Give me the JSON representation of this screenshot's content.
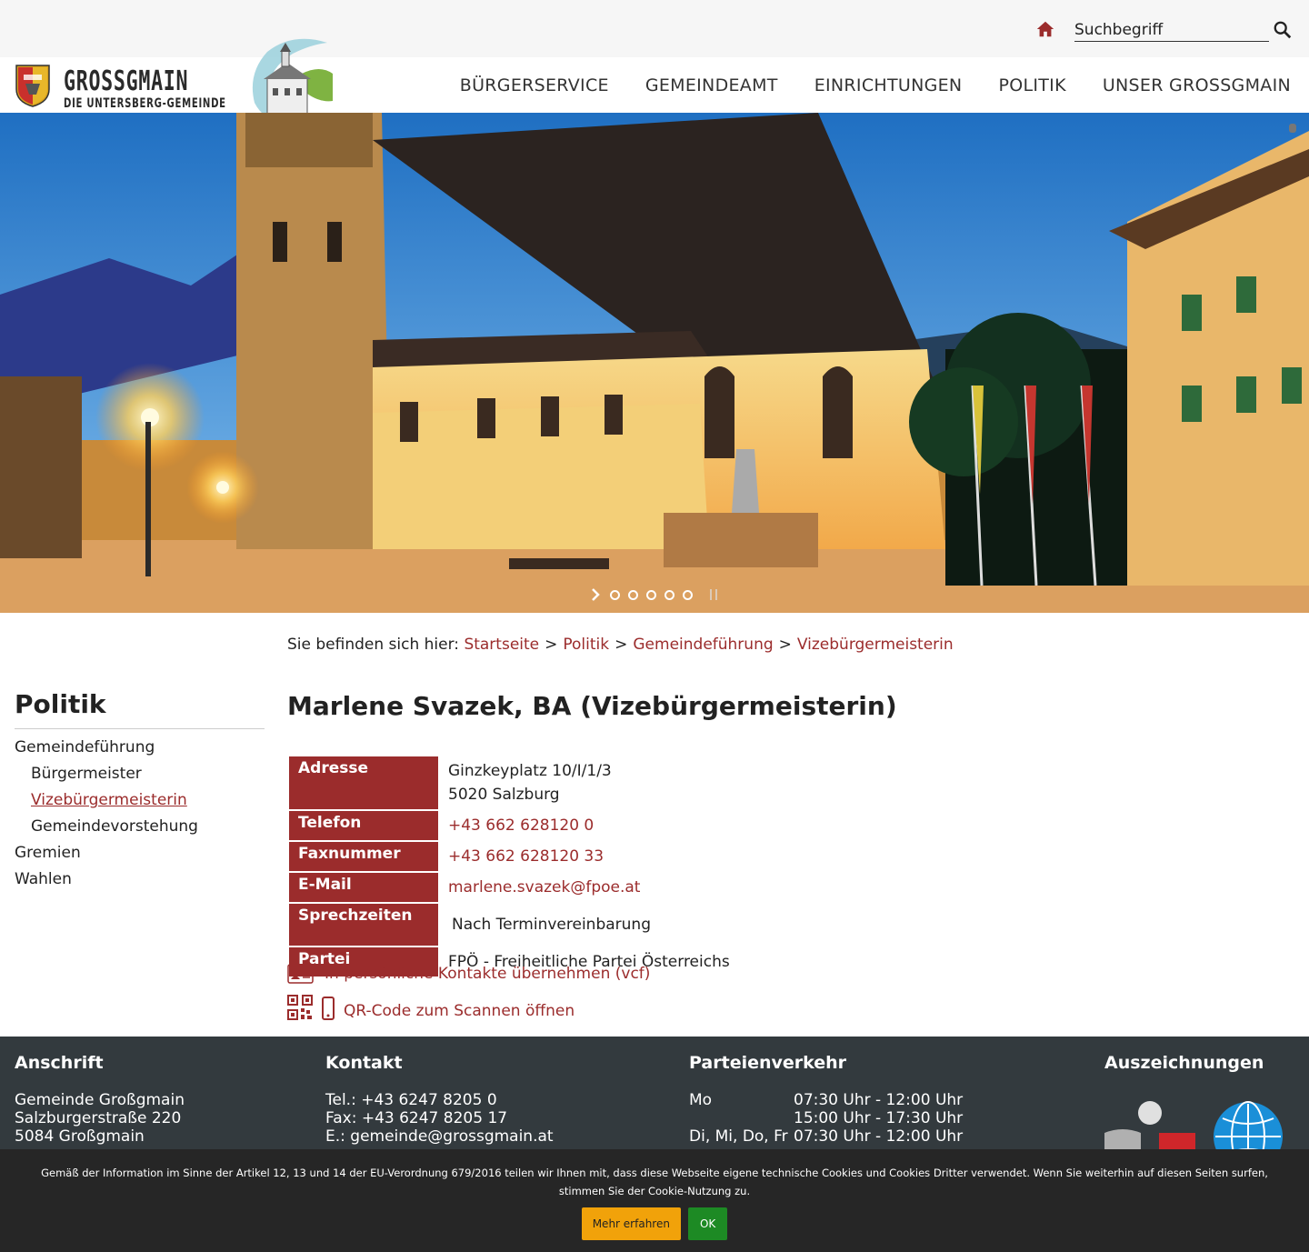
{
  "search": {
    "placeholder": "Suchbegriff"
  },
  "logo": {
    "title": "GROSSGMAIN",
    "subtitle": "DIE UNTERSBERG-GEMEINDE"
  },
  "nav": {
    "items": [
      {
        "label": "BÜRGERSERVICE"
      },
      {
        "label": "GEMEINDEAMT"
      },
      {
        "label": "EINRICHTUNGEN"
      },
      {
        "label": "POLITIK"
      },
      {
        "label": "UNSER GROSSGMAIN"
      }
    ]
  },
  "breadcrumb": {
    "prefix": "Sie befinden sich hier:",
    "items": [
      "Startseite",
      "Politik",
      "Gemeindeführung",
      "Vizebürgermeisterin"
    ],
    "separator": ">"
  },
  "sidebar": {
    "title": "Politik",
    "items": [
      {
        "label": "Gemeindeführung"
      },
      {
        "label": "Bürgermeister"
      },
      {
        "label": "Vizebürgermeisterin"
      },
      {
        "label": "Gemeindevorstehung"
      },
      {
        "label": "Gremien"
      },
      {
        "label": "Wahlen"
      }
    ]
  },
  "main": {
    "title": "Marlene Svazek, BA (Vizebürgermeisterin)",
    "table": {
      "address_label": "Adresse",
      "address_line1": "Ginzkeyplatz 10/I/1/3",
      "address_line2": "5020 Salzburg",
      "phone_label": "Telefon",
      "phone": "+43 662 628120 0",
      "fax_label": "Faxnummer",
      "fax": "+43 662 628120 33",
      "email_label": "E-Mail",
      "email": "marlene.svazek@fpoe.at",
      "hours_label": "Sprechzeiten",
      "hours": "Nach Terminvereinbarung",
      "party_label": "Partei",
      "party": "FPÖ - Freiheitliche Partei Österreichs"
    },
    "vcf_link": "In persönliche Kontakte übernehmen (vcf)",
    "qr_link": "QR-Code zum Scannen öffnen"
  },
  "footer": {
    "address": {
      "title": "Anschrift",
      "line1": "Gemeinde Großgmain",
      "line2": "Salzburgerstraße 220",
      "line3": "5084 Großgmain"
    },
    "contact": {
      "title": "Kontakt",
      "tel": "Tel.: +43 6247 8205 0",
      "fax": "Fax: +43 6247 8205 17",
      "email": "E.: gemeinde@grossgmain.at"
    },
    "hours": {
      "title": "Parteienverkehr",
      "rows": [
        {
          "day": "Mo",
          "time": "07:30 Uhr - 12:00 Uhr"
        },
        {
          "day": "",
          "time": "15:00 Uhr - 17:30 Uhr"
        },
        {
          "day": "Di, Mi, Do, Fr",
          "time": "07:30 Uhr - 12:00 Uhr"
        }
      ]
    },
    "awards": {
      "title": "Auszeichnungen"
    }
  },
  "cookie": {
    "text": "Gemäß der Information im Sinne der Artikel 12, 13 und 14 der EU-Verordnung 679/2016 teilen wir Ihnen mit, dass diese Webseite eigene technische Cookies und Cookies Dritter verwendet. Wenn Sie weiterhin auf diesen Seiten surfen, stimmen Sie der Cookie-Nutzung zu.",
    "more_button": "Mehr erfahren",
    "ok_button": "OK"
  },
  "colors": {
    "accent": "#9b2c2c",
    "footer_bg": "#333a3e",
    "cookie_bg": "#262626",
    "more_btn": "#f1a20a",
    "ok_btn": "#1d8a24"
  },
  "icons": [
    "home-icon",
    "search-icon",
    "slider-next-icon",
    "slider-pause-icon",
    "vcard-icon",
    "qr-code-icon",
    "phone-icon"
  ]
}
